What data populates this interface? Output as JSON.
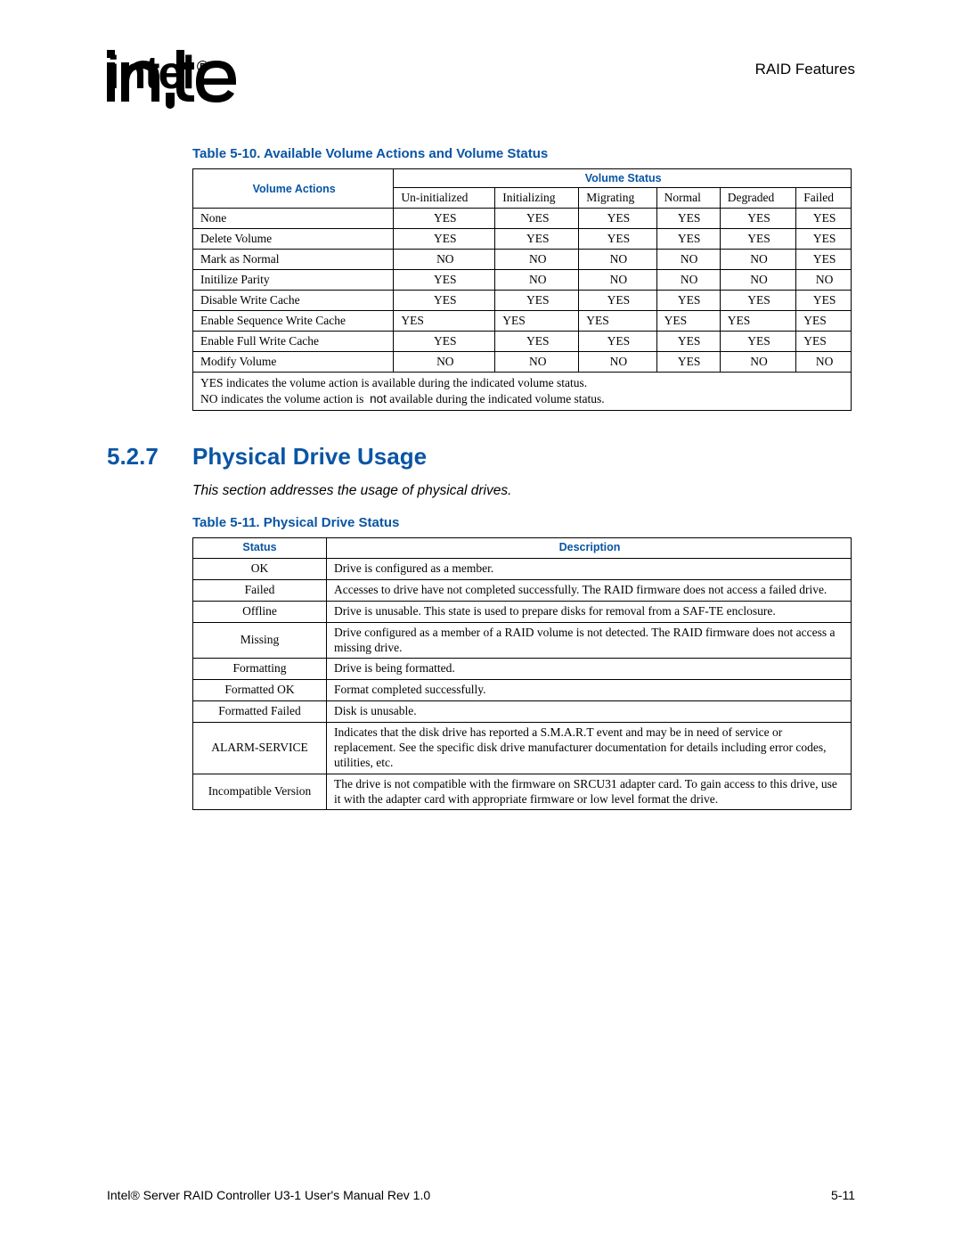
{
  "header": {
    "right": "RAID Features"
  },
  "table1": {
    "caption": "Table 5-10. Available Volume Actions and Volume Status",
    "col_actions": "Volume Actions",
    "col_status": "Volume Status",
    "status_cols": [
      "Un-initialized",
      "Initializing",
      "Migrating",
      "Normal",
      "Degraded",
      "Failed"
    ],
    "rows": [
      {
        "action": "None",
        "v": [
          "YES",
          "YES",
          "YES",
          "YES",
          "YES",
          "YES"
        ]
      },
      {
        "action": "Delete Volume",
        "v": [
          "YES",
          "YES",
          "YES",
          "YES",
          "YES",
          "YES"
        ]
      },
      {
        "action": "Mark as Normal",
        "v": [
          "NO",
          "NO",
          "NO",
          "NO",
          "NO",
          "YES"
        ]
      },
      {
        "action": "Initilize Parity",
        "v": [
          "YES",
          "NO",
          "NO",
          "NO",
          "NO",
          "NO"
        ]
      },
      {
        "action": "Disable Write Cache",
        "v": [
          "YES",
          "YES",
          "YES",
          "YES",
          "YES",
          "YES"
        ]
      },
      {
        "action": "Enable Sequence Write Cache",
        "v": [
          "YES",
          "YES",
          "YES",
          "YES",
          "YES",
          "YES"
        ]
      },
      {
        "action": "Enable Full Write Cache",
        "v": [
          "YES",
          "YES",
          "YES",
          "YES",
          "YES",
          "YES"
        ]
      },
      {
        "action": "Modify Volume",
        "v": [
          "NO",
          "NO",
          "NO",
          "YES",
          "NO",
          "NO"
        ]
      }
    ],
    "note1": "YES indicates the volume action is available during the indicated volume status.",
    "note2a": "NO indicates the volume action is ",
    "note2b": "not",
    "note2c": " available during the indicated volume status."
  },
  "section": {
    "num": "5.2.7",
    "title": "Physical Drive Usage",
    "intro": "This section addresses the usage of physical drives."
  },
  "table2": {
    "caption": "Table 5-11. Physical Drive Status",
    "col_status": "Status",
    "col_desc": "Description",
    "rows": [
      {
        "s": "OK",
        "d": "Drive is configured as a member."
      },
      {
        "s": "Failed",
        "d": "Accesses to drive have not completed successfully. The RAID firmware does not access a failed drive."
      },
      {
        "s": "Offline",
        "d": "Drive is unusable. This state is used to prepare disks for removal from a SAF-TE enclosure."
      },
      {
        "s": "Missing",
        "d": "Drive configured as a member of a RAID volume is not detected. The RAID firmware does not access a missing drive."
      },
      {
        "s": "Formatting",
        "d": "Drive is being formatted."
      },
      {
        "s": "Formatted OK",
        "d": "Format completed successfully."
      },
      {
        "s": "Formatted Failed",
        "d": "Disk is unusable."
      },
      {
        "s": "ALARM-SERVICE",
        "d": "Indicates that the disk drive has reported a S.M.A.R.T event and may be in need of service or replacement.  See the specific disk drive manufacturer documentation for details including error codes, utilities, etc."
      },
      {
        "s": "Incompatible Version",
        "d": "The drive is not compatible with the firmware on SRCU31 adapter card. To gain access to this drive, use it with the adapter card with appropriate firmware or low level format the drive."
      }
    ]
  },
  "footer": {
    "left": "Intel® Server RAID Controller U3-1 User's Manual Rev 1.0",
    "right": "5-11"
  }
}
